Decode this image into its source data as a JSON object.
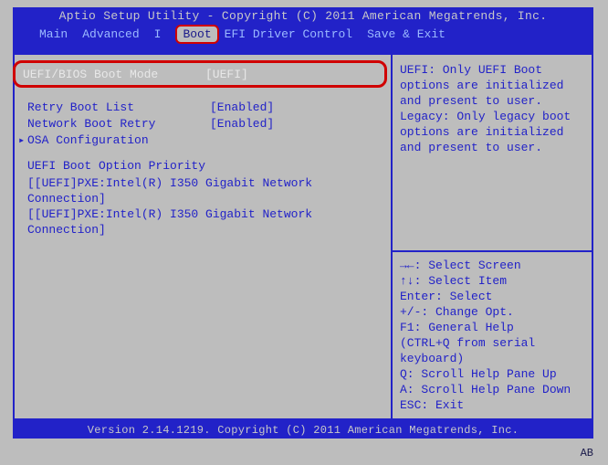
{
  "header": {
    "title": "Aptio Setup Utility - Copyright (C) 2011 American Megatrends, Inc.",
    "tabs": [
      "Main",
      "Advanced",
      "I",
      "Boot",
      "EFI Driver Control",
      "Save & Exit"
    ],
    "active_tab_index": 3
  },
  "left": {
    "selected": {
      "label": "UEFI/BIOS Boot Mode",
      "value": "[UEFI]"
    },
    "items": [
      {
        "label": "Retry Boot List",
        "value": "[Enabled]"
      },
      {
        "label": "Network Boot Retry",
        "value": "[Enabled]"
      },
      {
        "label": "OSA Configuration",
        "value": "",
        "submenu": true
      }
    ],
    "priority_heading": "UEFI Boot Option Priority",
    "boot_entries": [
      "[[UEFI]PXE:Intel(R) I350 Gigabit Network Connection]",
      "[[UEFI]PXE:Intel(R) I350 Gigabit Network Connection]"
    ]
  },
  "help": {
    "description": "UEFI: Only UEFI Boot options are initialized and present to user. Legacy: Only legacy boot options are initialized and present to user.",
    "keys": [
      "→←: Select Screen",
      "↑↓: Select Item",
      "Enter: Select",
      "+/-: Change Opt.",
      "F1: General Help",
      " (CTRL+Q from serial",
      " keyboard)",
      "Q: Scroll Help Pane Up",
      "A: Scroll Help Pane Down",
      "ESC: Exit"
    ]
  },
  "footer": {
    "version": "Version 2.14.1219. Copyright (C) 2011 American Megatrends, Inc.",
    "badge": "AB"
  }
}
